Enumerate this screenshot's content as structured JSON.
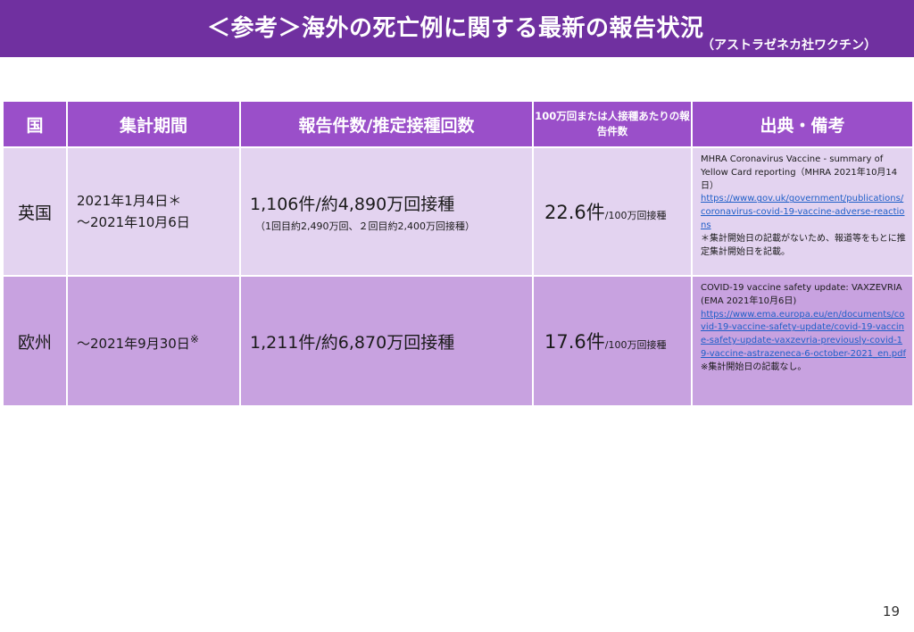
{
  "header": {
    "title": "＜参考＞海外の死亡例に関する最新の報告状況",
    "subtitle": "（アストラゼネカ社ワクチン）"
  },
  "table": {
    "columns": [
      "国",
      "集計期間",
      "報告件数/推定接種回数",
      "100万回または人接種あたりの報告件数",
      "出典・備考"
    ],
    "rows": [
      {
        "country": "英国",
        "period_line1": "2021年1月4日＊",
        "period_line2": "～2021年10月6日",
        "reports_main": "1,106件/約4,890万回接種",
        "reports_note": "（1回目約2,490万回、２回目約2,400万回接種）",
        "rate_value": "22.6件",
        "rate_unit": "/100万回接種",
        "source_text": "MHRA Coronavirus Vaccine - summary of Yellow Card reporting（MHRA 2021年10月14日）",
        "source_url": "https://www.gov.uk/government/publications/coronavirus-covid-19-vaccine-adverse-reactions",
        "source_note": "＊集計開始日の記載がないため、報道等をもとに推定集計開始日を記載。"
      },
      {
        "country": "欧州",
        "period_line1": "～2021年9月30日",
        "period_mark": "※",
        "reports_main": "1,211件/約6,870万回接種",
        "rate_value": "17.6件",
        "rate_unit": "/100万回接種",
        "source_text": "COVID-19 vaccine safety update: VAXZEVRIA (EMA 2021年10月6日)",
        "source_url": "https://www.ema.europa.eu/en/documents/covid-19-vaccine-safety-update/covid-19-vaccine-safety-update-vaxzevria-previously-covid-19-vaccine-astrazeneca-6-october-2021_en.pdf",
        "source_note": "※集計開始日の記載なし。"
      }
    ]
  },
  "page_number": "19"
}
